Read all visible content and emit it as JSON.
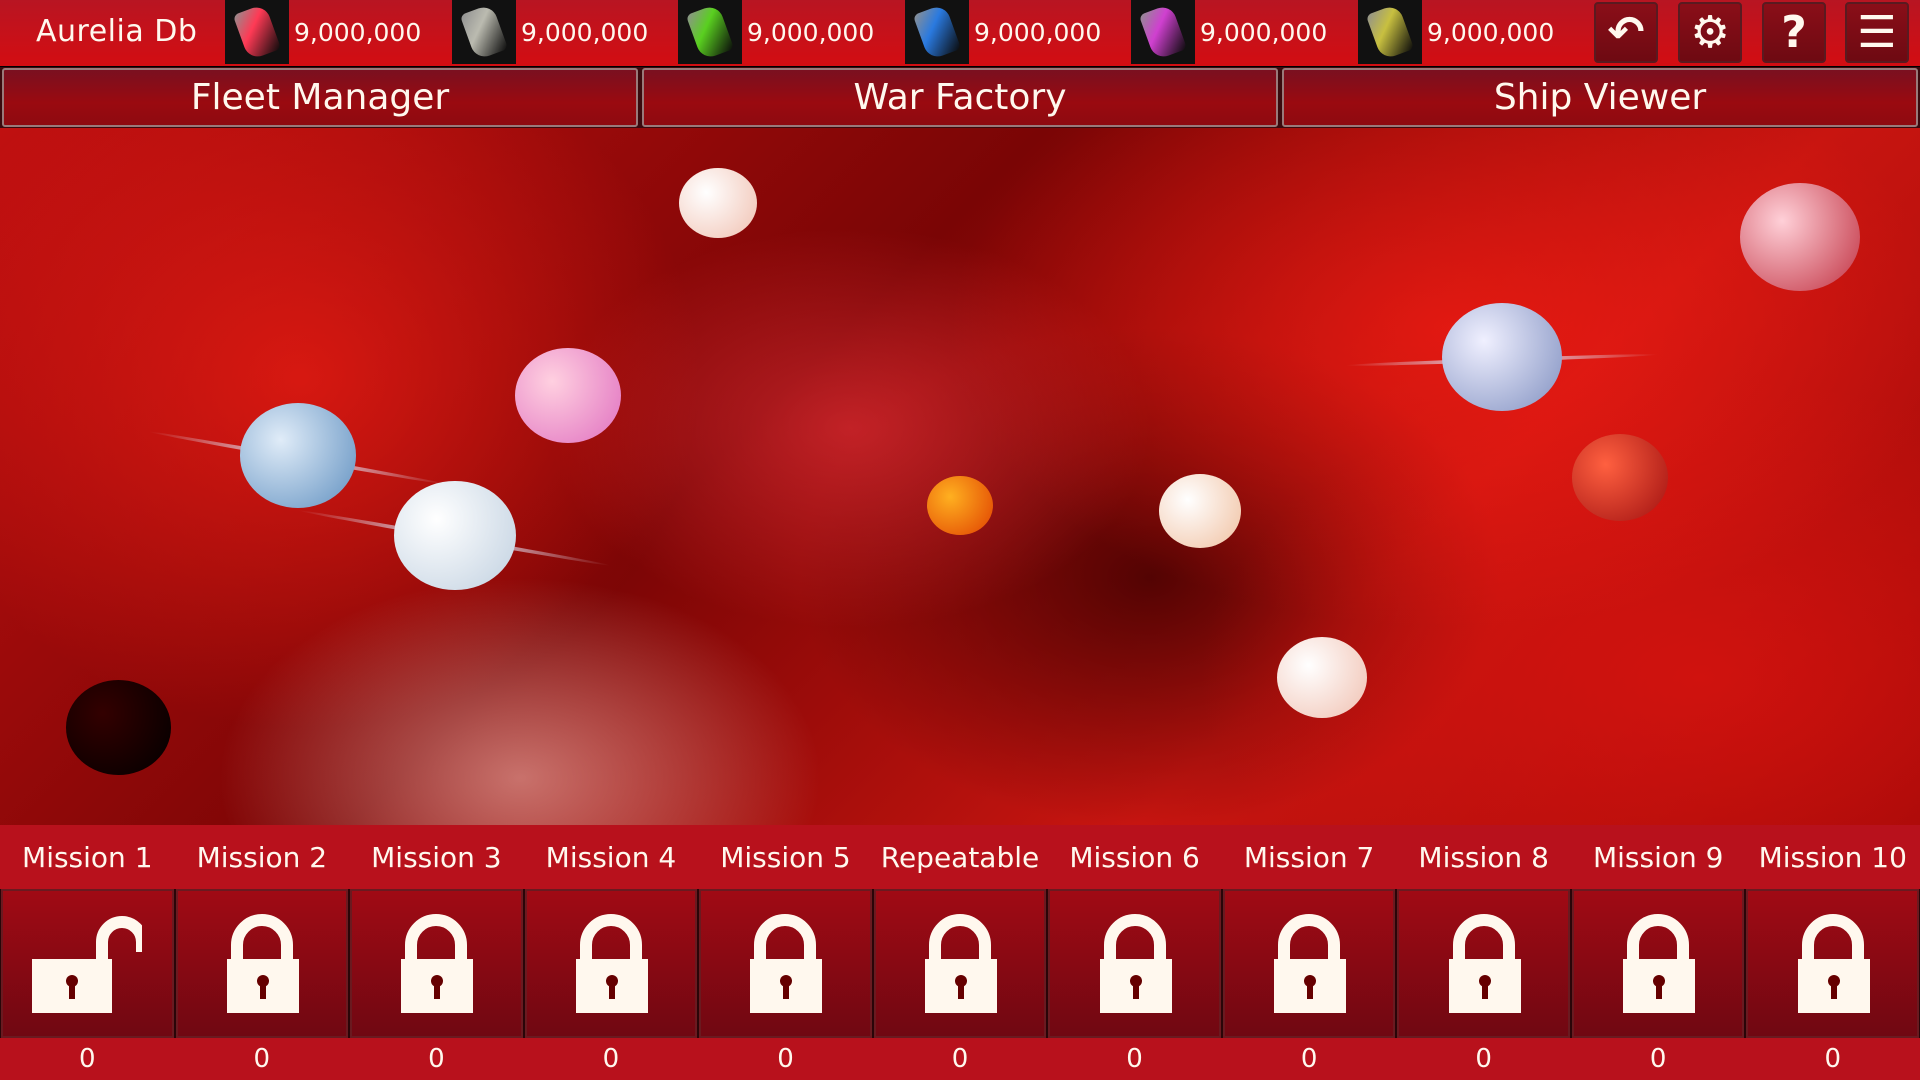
{
  "header": {
    "title": "Aurelia Db",
    "resources": [
      {
        "icon": "red-crystal-icon",
        "value": "9,000,000",
        "color": "#ff3a55"
      },
      {
        "icon": "grey-ore-icon",
        "value": "9,000,000",
        "color": "#bbbbb0"
      },
      {
        "icon": "green-crystal-icon",
        "value": "9,000,000",
        "color": "#5ad020"
      },
      {
        "icon": "blue-crystal-icon",
        "value": "9,000,000",
        "color": "#2a7ae0"
      },
      {
        "icon": "purple-ore-icon",
        "value": "9,000,000",
        "color": "#d040d0"
      },
      {
        "icon": "gold-bar-icon",
        "value": "9,000,000",
        "color": "#c8c040"
      }
    ],
    "buttons": [
      {
        "icon": "back-icon",
        "glyph": "↶"
      },
      {
        "icon": "settings-icon",
        "glyph": "⚙"
      },
      {
        "icon": "help-icon",
        "glyph": "?"
      },
      {
        "icon": "menu-icon",
        "glyph": "☰"
      }
    ]
  },
  "tabs": [
    "Fleet Manager",
    "War Factory",
    "Ship Viewer"
  ],
  "missions": [
    {
      "label": "Mission 1",
      "locked": false,
      "count": "0"
    },
    {
      "label": "Mission 2",
      "locked": true,
      "count": "0"
    },
    {
      "label": "Mission 3",
      "locked": true,
      "count": "0"
    },
    {
      "label": "Mission 4",
      "locked": true,
      "count": "0"
    },
    {
      "label": "Mission 5",
      "locked": true,
      "count": "0"
    },
    {
      "label": "Repeatable",
      "locked": true,
      "count": "0"
    },
    {
      "label": "Mission 6",
      "locked": true,
      "count": "0"
    },
    {
      "label": "Mission 7",
      "locked": true,
      "count": "0"
    },
    {
      "label": "Mission 8",
      "locked": true,
      "count": "0"
    },
    {
      "label": "Mission 9",
      "locked": true,
      "count": "0"
    },
    {
      "label": "Mission 10",
      "locked": true,
      "count": "0"
    }
  ],
  "colors": {
    "bar": "#b8111c",
    "tile": "#8a0a14",
    "text": "#fff8ee"
  }
}
